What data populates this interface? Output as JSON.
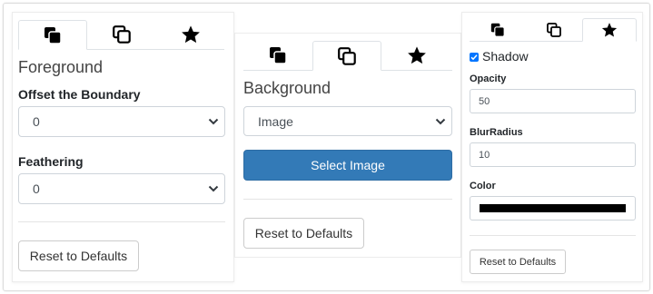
{
  "panels": {
    "foreground": {
      "heading": "Foreground",
      "offset_label": "Offset the Boundary",
      "offset_value": "0",
      "feathering_label": "Feathering",
      "feathering_value": "0",
      "reset_label": "Reset to Defaults",
      "active_tab": 0
    },
    "background": {
      "heading": "Background",
      "type_value": "Image",
      "select_image_label": "Select Image",
      "reset_label": "Reset to Defaults",
      "active_tab": 1
    },
    "effects": {
      "shadow_label": "Shadow",
      "shadow_checked": true,
      "opacity_label": "Opacity",
      "opacity_value": "50",
      "blur_label": "BlurRadius",
      "blur_value": "10",
      "color_label": "Color",
      "color_value": "#000000",
      "reset_label": "Reset to Defaults",
      "active_tab": 2
    }
  },
  "tabs": [
    "foreground-layers-icon",
    "background-layers-icon",
    "star-icon"
  ],
  "colors": {
    "primary": "#337ab7",
    "border": "#ced4da",
    "checkbox": "#0075ff",
    "text": "#212529"
  }
}
